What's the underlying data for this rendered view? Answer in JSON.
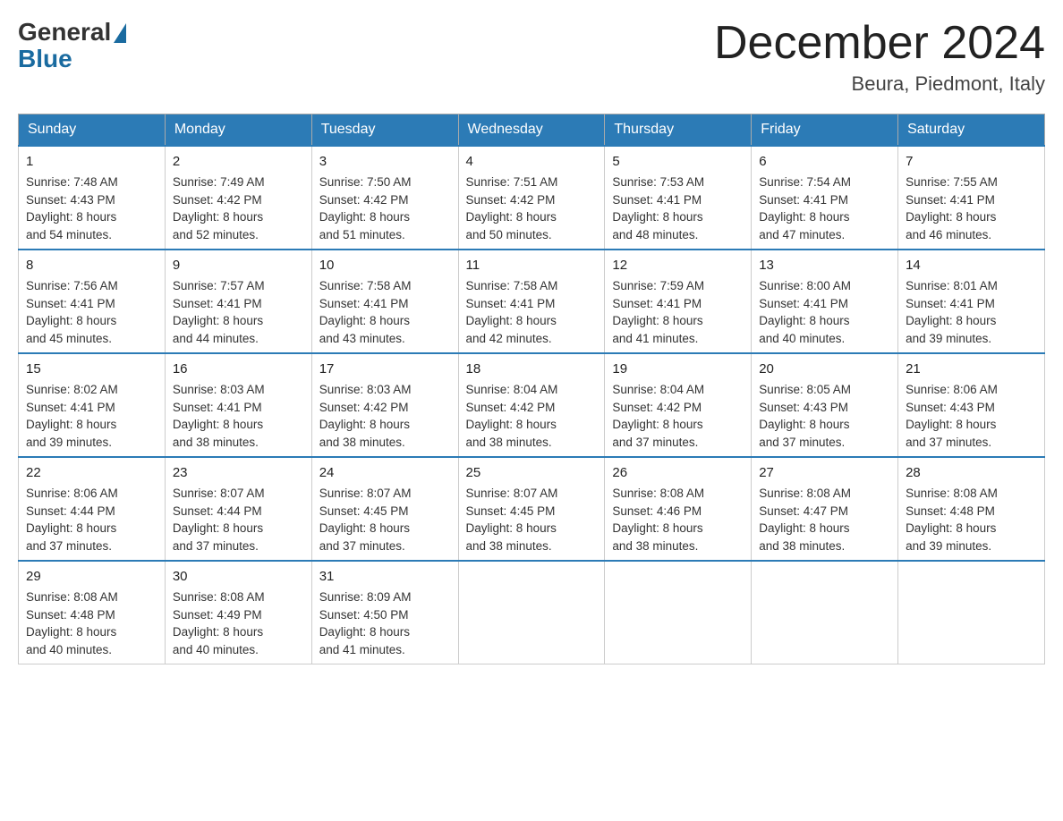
{
  "header": {
    "logo_general": "General",
    "logo_blue": "Blue",
    "month_title": "December 2024",
    "location": "Beura, Piedmont, Italy"
  },
  "days_of_week": [
    "Sunday",
    "Monday",
    "Tuesday",
    "Wednesday",
    "Thursday",
    "Friday",
    "Saturday"
  ],
  "weeks": [
    [
      {
        "day": "1",
        "sunrise": "7:48 AM",
        "sunset": "4:43 PM",
        "daylight": "8 hours and 54 minutes."
      },
      {
        "day": "2",
        "sunrise": "7:49 AM",
        "sunset": "4:42 PM",
        "daylight": "8 hours and 52 minutes."
      },
      {
        "day": "3",
        "sunrise": "7:50 AM",
        "sunset": "4:42 PM",
        "daylight": "8 hours and 51 minutes."
      },
      {
        "day": "4",
        "sunrise": "7:51 AM",
        "sunset": "4:42 PM",
        "daylight": "8 hours and 50 minutes."
      },
      {
        "day": "5",
        "sunrise": "7:53 AM",
        "sunset": "4:41 PM",
        "daylight": "8 hours and 48 minutes."
      },
      {
        "day": "6",
        "sunrise": "7:54 AM",
        "sunset": "4:41 PM",
        "daylight": "8 hours and 47 minutes."
      },
      {
        "day": "7",
        "sunrise": "7:55 AM",
        "sunset": "4:41 PM",
        "daylight": "8 hours and 46 minutes."
      }
    ],
    [
      {
        "day": "8",
        "sunrise": "7:56 AM",
        "sunset": "4:41 PM",
        "daylight": "8 hours and 45 minutes."
      },
      {
        "day": "9",
        "sunrise": "7:57 AM",
        "sunset": "4:41 PM",
        "daylight": "8 hours and 44 minutes."
      },
      {
        "day": "10",
        "sunrise": "7:58 AM",
        "sunset": "4:41 PM",
        "daylight": "8 hours and 43 minutes."
      },
      {
        "day": "11",
        "sunrise": "7:58 AM",
        "sunset": "4:41 PM",
        "daylight": "8 hours and 42 minutes."
      },
      {
        "day": "12",
        "sunrise": "7:59 AM",
        "sunset": "4:41 PM",
        "daylight": "8 hours and 41 minutes."
      },
      {
        "day": "13",
        "sunrise": "8:00 AM",
        "sunset": "4:41 PM",
        "daylight": "8 hours and 40 minutes."
      },
      {
        "day": "14",
        "sunrise": "8:01 AM",
        "sunset": "4:41 PM",
        "daylight": "8 hours and 39 minutes."
      }
    ],
    [
      {
        "day": "15",
        "sunrise": "8:02 AM",
        "sunset": "4:41 PM",
        "daylight": "8 hours and 39 minutes."
      },
      {
        "day": "16",
        "sunrise": "8:03 AM",
        "sunset": "4:41 PM",
        "daylight": "8 hours and 38 minutes."
      },
      {
        "day": "17",
        "sunrise": "8:03 AM",
        "sunset": "4:42 PM",
        "daylight": "8 hours and 38 minutes."
      },
      {
        "day": "18",
        "sunrise": "8:04 AM",
        "sunset": "4:42 PM",
        "daylight": "8 hours and 38 minutes."
      },
      {
        "day": "19",
        "sunrise": "8:04 AM",
        "sunset": "4:42 PM",
        "daylight": "8 hours and 37 minutes."
      },
      {
        "day": "20",
        "sunrise": "8:05 AM",
        "sunset": "4:43 PM",
        "daylight": "8 hours and 37 minutes."
      },
      {
        "day": "21",
        "sunrise": "8:06 AM",
        "sunset": "4:43 PM",
        "daylight": "8 hours and 37 minutes."
      }
    ],
    [
      {
        "day": "22",
        "sunrise": "8:06 AM",
        "sunset": "4:44 PM",
        "daylight": "8 hours and 37 minutes."
      },
      {
        "day": "23",
        "sunrise": "8:07 AM",
        "sunset": "4:44 PM",
        "daylight": "8 hours and 37 minutes."
      },
      {
        "day": "24",
        "sunrise": "8:07 AM",
        "sunset": "4:45 PM",
        "daylight": "8 hours and 37 minutes."
      },
      {
        "day": "25",
        "sunrise": "8:07 AM",
        "sunset": "4:45 PM",
        "daylight": "8 hours and 38 minutes."
      },
      {
        "day": "26",
        "sunrise": "8:08 AM",
        "sunset": "4:46 PM",
        "daylight": "8 hours and 38 minutes."
      },
      {
        "day": "27",
        "sunrise": "8:08 AM",
        "sunset": "4:47 PM",
        "daylight": "8 hours and 38 minutes."
      },
      {
        "day": "28",
        "sunrise": "8:08 AM",
        "sunset": "4:48 PM",
        "daylight": "8 hours and 39 minutes."
      }
    ],
    [
      {
        "day": "29",
        "sunrise": "8:08 AM",
        "sunset": "4:48 PM",
        "daylight": "8 hours and 40 minutes."
      },
      {
        "day": "30",
        "sunrise": "8:08 AM",
        "sunset": "4:49 PM",
        "daylight": "8 hours and 40 minutes."
      },
      {
        "day": "31",
        "sunrise": "8:09 AM",
        "sunset": "4:50 PM",
        "daylight": "8 hours and 41 minutes."
      },
      null,
      null,
      null,
      null
    ]
  ],
  "labels": {
    "sunrise": "Sunrise:",
    "sunset": "Sunset:",
    "daylight": "Daylight:"
  }
}
